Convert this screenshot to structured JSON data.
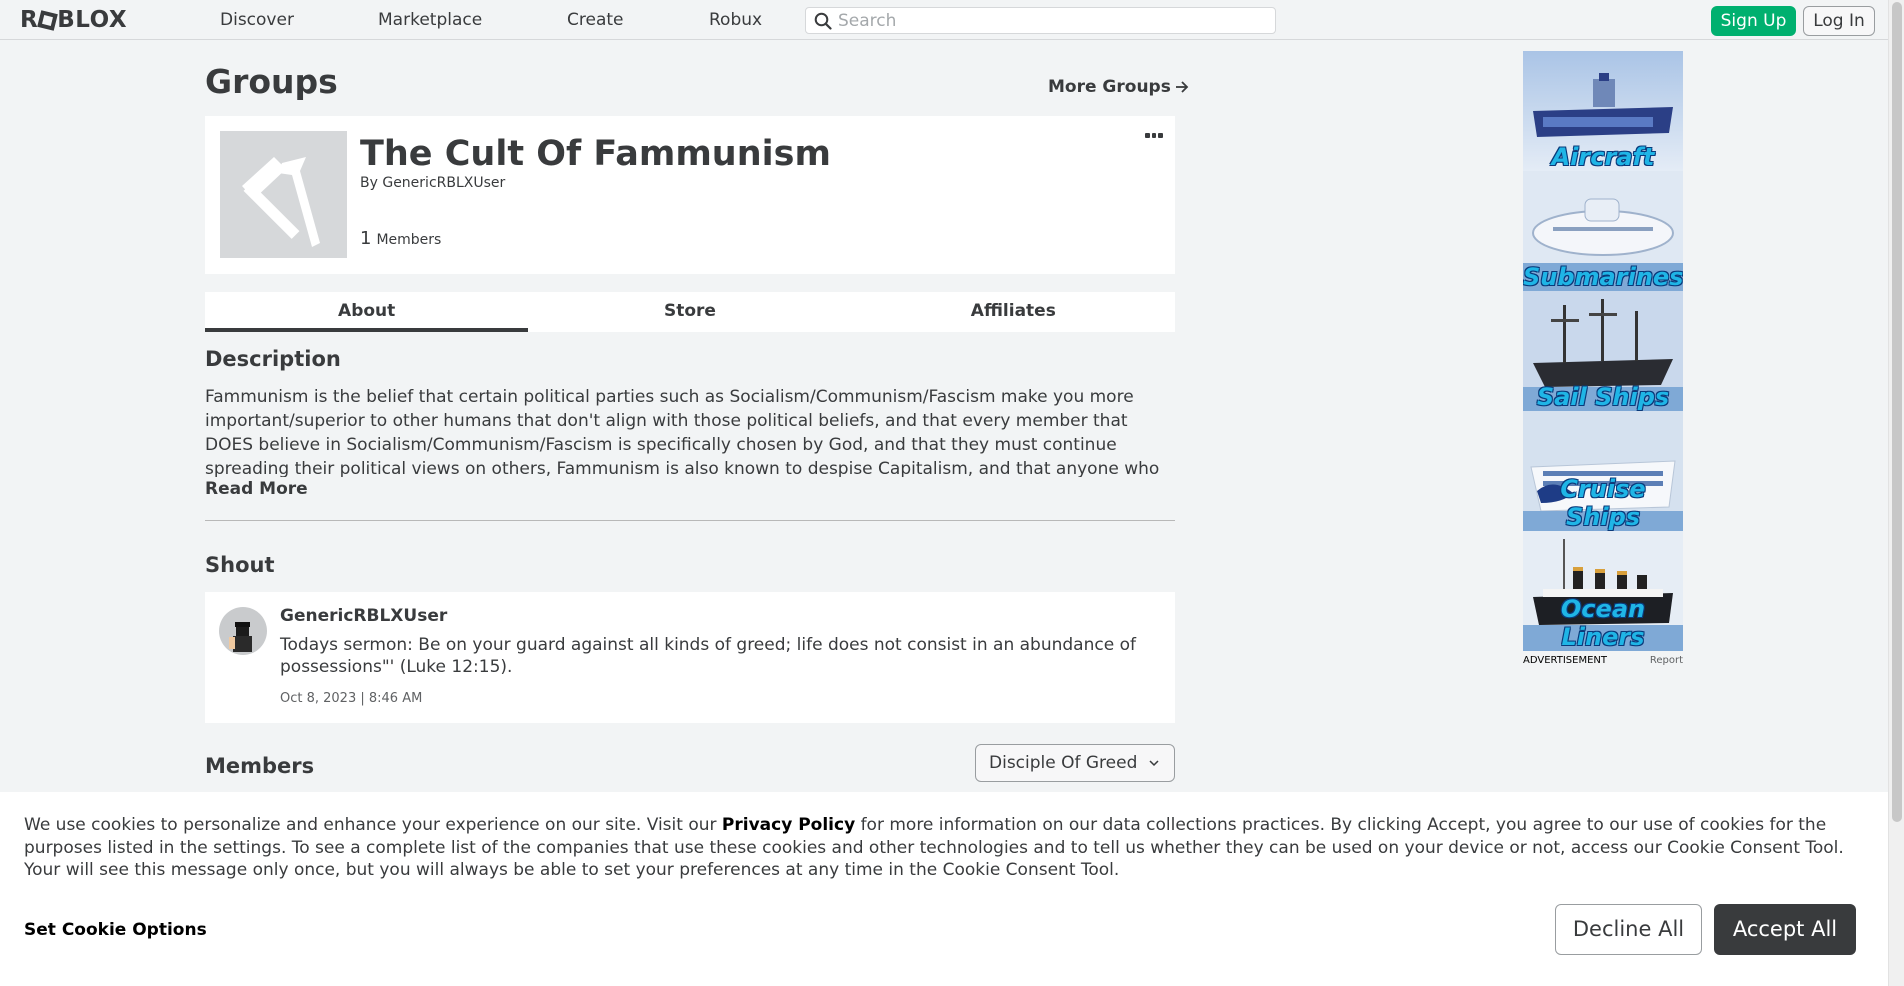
{
  "nav": {
    "logo_text": "ROBLOX",
    "links": [
      "Discover",
      "Marketplace",
      "Create",
      "Robux"
    ],
    "search_placeholder": "Search",
    "signup_label": "Sign Up",
    "login_label": "Log In"
  },
  "page": {
    "title": "Groups",
    "more_groups_label": "More Groups"
  },
  "group": {
    "name": "The Cult Of Fammunism",
    "owner_prefix": "By",
    "owner": "GenericRBLXUser",
    "member_count": "1",
    "member_label": "Members"
  },
  "tabs": [
    "About",
    "Store",
    "Affiliates"
  ],
  "about": {
    "description_title": "Description",
    "description": "Fammunism is the belief that certain political parties such as Socialism/Communism/Fascism make you more important/superior to other humans that don't align with those political beliefs, and that every member that DOES believe in Socialism/Communism/Fascism is specifically chosen by God, and that they must continue spreading their political views on others, Fammunism is also known to despise Capitalism, and that anyone who IS",
    "read_more_label": "Read More",
    "shout_title": "Shout",
    "members_title": "Members"
  },
  "shout": {
    "user": "GenericRBLXUser",
    "text": "Todays sermon: Be on your guard against all kinds of greed; life does not consist in an abundance of possessions\"' (Luke 12:15).",
    "date": "Oct 8, 2023 | 8:46 AM"
  },
  "members_role_select": "Disciple Of Greed",
  "ad": {
    "panels": [
      "Aircraft",
      "Submarines",
      "Sail Ships",
      "Cruise Ships",
      "Ocean Liners"
    ],
    "footer_label": "ADVERTISEMENT",
    "report_label": "Report"
  },
  "cookie": {
    "text_before": "We use cookies to personalize and enhance your experience on our site. Visit our ",
    "privacy_link": "Privacy Policy",
    "text_after": " for more information on our data collections practices. By clicking Accept, you agree to our use of cookies for the purposes listed in the settings. To see a complete list of the companies that use these cookies and other technologies and to tell us whether they can be used on your device or not, access our Cookie Consent Tool. Your will see this message only once, but you will always be able to set your preferences at any time in the Cookie Consent Tool.",
    "options_label": "Set Cookie Options",
    "decline_label": "Decline All",
    "accept_label": "Accept All"
  },
  "colors": {
    "signup_green": "#00b06f",
    "page_bg": "#f2f4f5",
    "text": "#393b3d",
    "accept_bg": "#393b3d"
  }
}
